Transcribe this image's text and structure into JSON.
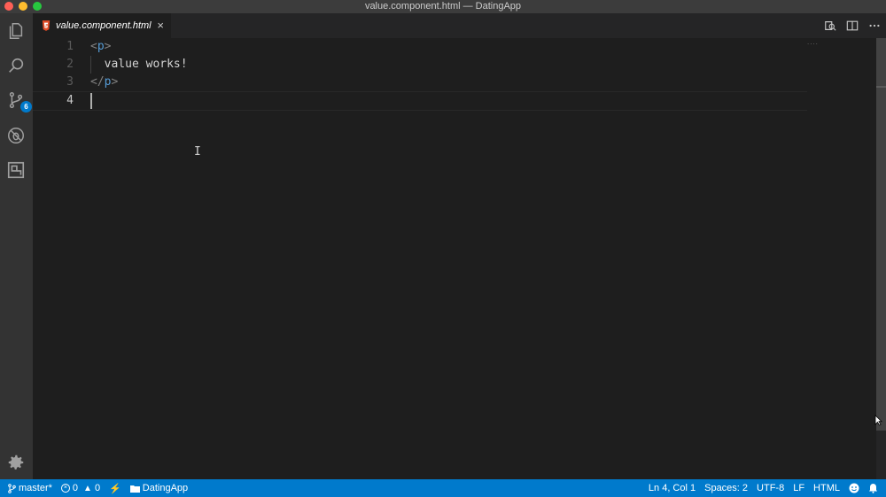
{
  "window": {
    "title": "value.component.html — DatingApp"
  },
  "activity_bar": {
    "items": [
      {
        "name": "explorer",
        "icon": "files-icon"
      },
      {
        "name": "search",
        "icon": "search-icon"
      },
      {
        "name": "source-control",
        "icon": "git-branch-icon",
        "badge": "6"
      },
      {
        "name": "debug",
        "icon": "debug-icon"
      },
      {
        "name": "extensions",
        "icon": "extensions-icon"
      }
    ],
    "settings_icon": "gear-icon"
  },
  "tabs": [
    {
      "label": "value.component.html",
      "icon": "html5-icon",
      "close": "×",
      "active": true
    }
  ],
  "editor": {
    "lines": [
      {
        "number": "1",
        "open": "<",
        "tag": "p",
        "close": ">"
      },
      {
        "number": "2",
        "text": "  value works!"
      },
      {
        "number": "3",
        "open": "</",
        "tag": "p",
        "close": ">"
      },
      {
        "number": "4",
        "text": ""
      }
    ],
    "minimap": "....",
    "ibeam": "I"
  },
  "status_bar": {
    "branch": "master*",
    "errors": "0",
    "warnings": "0",
    "folder": "DatingApp",
    "position": "Ln 4, Col 1",
    "spaces": "Spaces: 2",
    "encoding": "UTF-8",
    "eol": "LF",
    "language": "HTML"
  },
  "colors": {
    "status_bar": "#007acc",
    "editor_bg": "#1e1e1e",
    "tag": "#569cd6"
  }
}
